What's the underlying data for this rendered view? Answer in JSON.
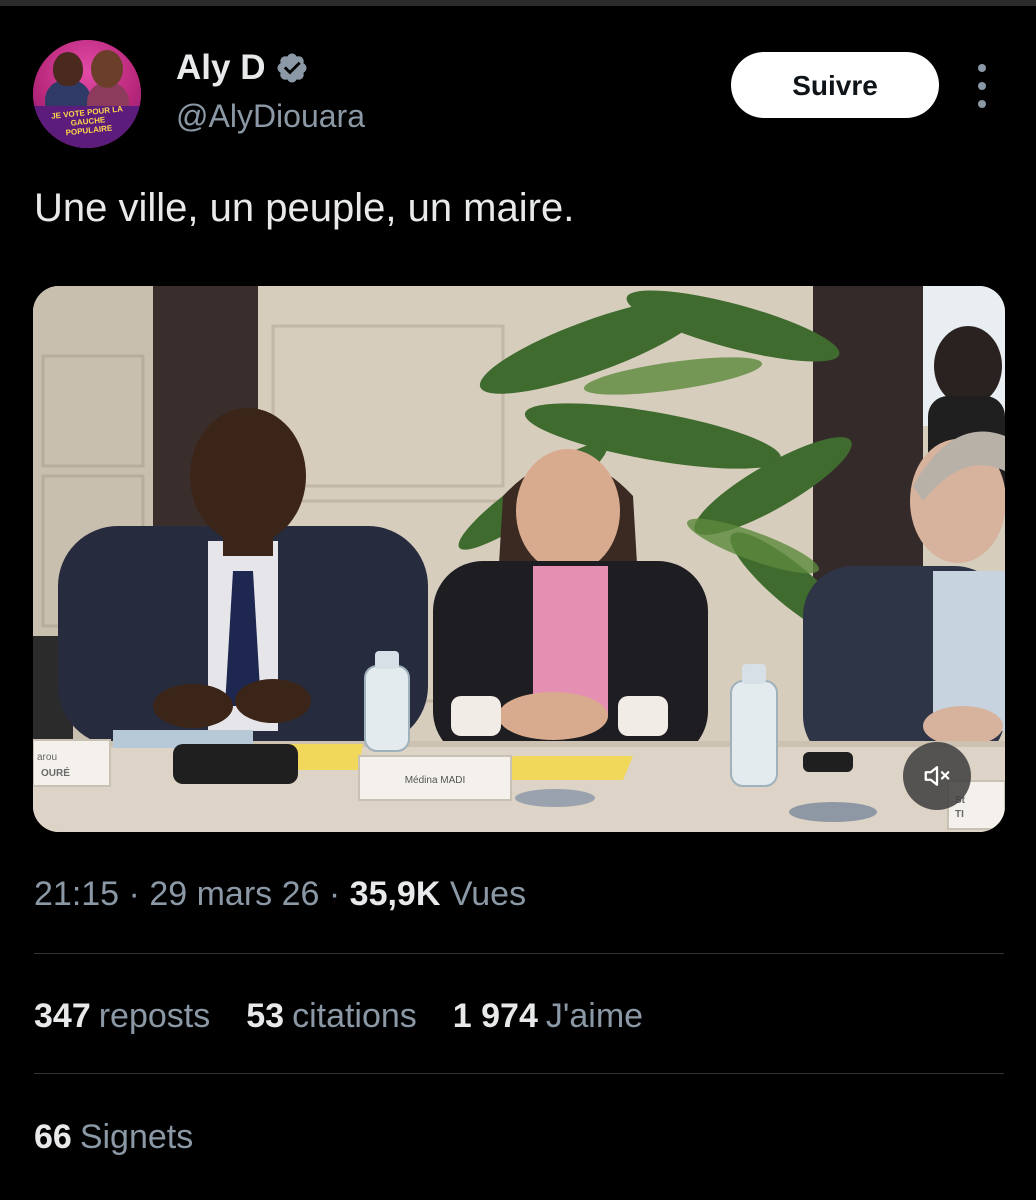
{
  "author": {
    "display_name": "Aly D",
    "handle": "@AlyDiouara",
    "avatar_slogan": "JE VOTE POUR LA GAUCHE POPULAIRE",
    "verified_icon": "verified-badge-icon"
  },
  "actions": {
    "follow_label": "Suivre",
    "more_icon": "more-options-icon"
  },
  "tweet": {
    "text": "Une ville, un peuple, un maire."
  },
  "media": {
    "type": "video",
    "nameplates": {
      "left": "arou\nOURÉ",
      "center": "Médina MADI",
      "right": "St\nTI"
    },
    "mute_icon": "mute-icon"
  },
  "meta": {
    "time": "21:15",
    "separator": "·",
    "date": "29 mars 26",
    "views_count": "35,9K",
    "views_label": "Vues"
  },
  "stats": {
    "reposts_count": "347",
    "reposts_label": "reposts",
    "quotes_count": "53",
    "quotes_label": "citations",
    "likes_count": "1 974",
    "likes_label": "J'aime",
    "bookmarks_count": "66",
    "bookmarks_label": "Signets"
  },
  "colors": {
    "background": "#000000",
    "primary_text": "#e7e9ea",
    "secondary_text": "#8b98a5",
    "verified": "#8b98a5",
    "divider": "#2f3336"
  }
}
